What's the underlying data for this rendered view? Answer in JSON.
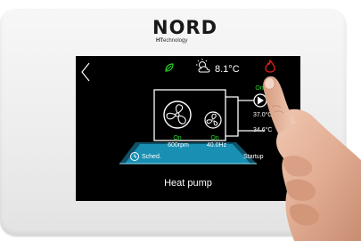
{
  "brand": {
    "name": "NORD",
    "subtitle_bold": "HT",
    "subtitle_rest": "echnology"
  },
  "screen": {
    "status": {
      "leaf_icon": "leaf-icon",
      "weather_icon": "sun-cloud-icon",
      "outdoor_temp": "8.1°C",
      "flame_icon": "flame-icon",
      "back_icon": "chevron-left-icon"
    },
    "unit": {
      "fan_status": "On",
      "fan_speed": "600rpm",
      "compressor_status": "On",
      "compressor_freq": "40.0Hz"
    },
    "pump": {
      "status": "On",
      "temp_out": "37.0°C",
      "temp_return": "34.6°C"
    },
    "band": {
      "left_label": "Sched.",
      "right_label": "Startup"
    },
    "title": "Heat pump"
  },
  "colors": {
    "status_green": "#2bd42b",
    "flame_red": "#e0241b",
    "band_cyan": "#1fb6e8",
    "screen_bg": "#000000"
  }
}
